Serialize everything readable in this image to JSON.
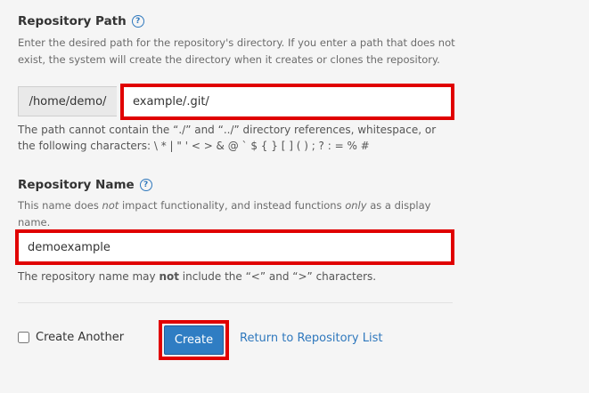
{
  "repository_path": {
    "label": "Repository Path",
    "description": "Enter the desired path for the repository's directory. If you enter a path that does not exist, the system will create the directory when it creates or clones the repository.",
    "prefix": "/home/demo/",
    "value": "example/.git/",
    "hint": "The path cannot contain the “./” and “../” directory references, whitespace, or the following characters: \\ * | \" ' < > & @ ` $ { } [ ] ( ) ; ? : = % #"
  },
  "repository_name": {
    "label": "Repository Name",
    "description_pre": "This name does ",
    "description_em1": "not",
    "description_mid": " impact functionality, and instead functions ",
    "description_em2": "only",
    "description_post": " as a display name.",
    "value": "demoexample",
    "hint_pre": "The repository name may ",
    "hint_strong": "not",
    "hint_post": " include the “<” and “>” characters."
  },
  "actions": {
    "create_another_label": "Create Another",
    "create_another_checked": false,
    "create_label": "Create",
    "return_link_label": "Return to Repository List"
  },
  "colors": {
    "highlight": "#e00000",
    "primary_button": "#2f7dc3",
    "link": "#2f78bd"
  },
  "icons": {
    "help": "help-circle-icon"
  }
}
